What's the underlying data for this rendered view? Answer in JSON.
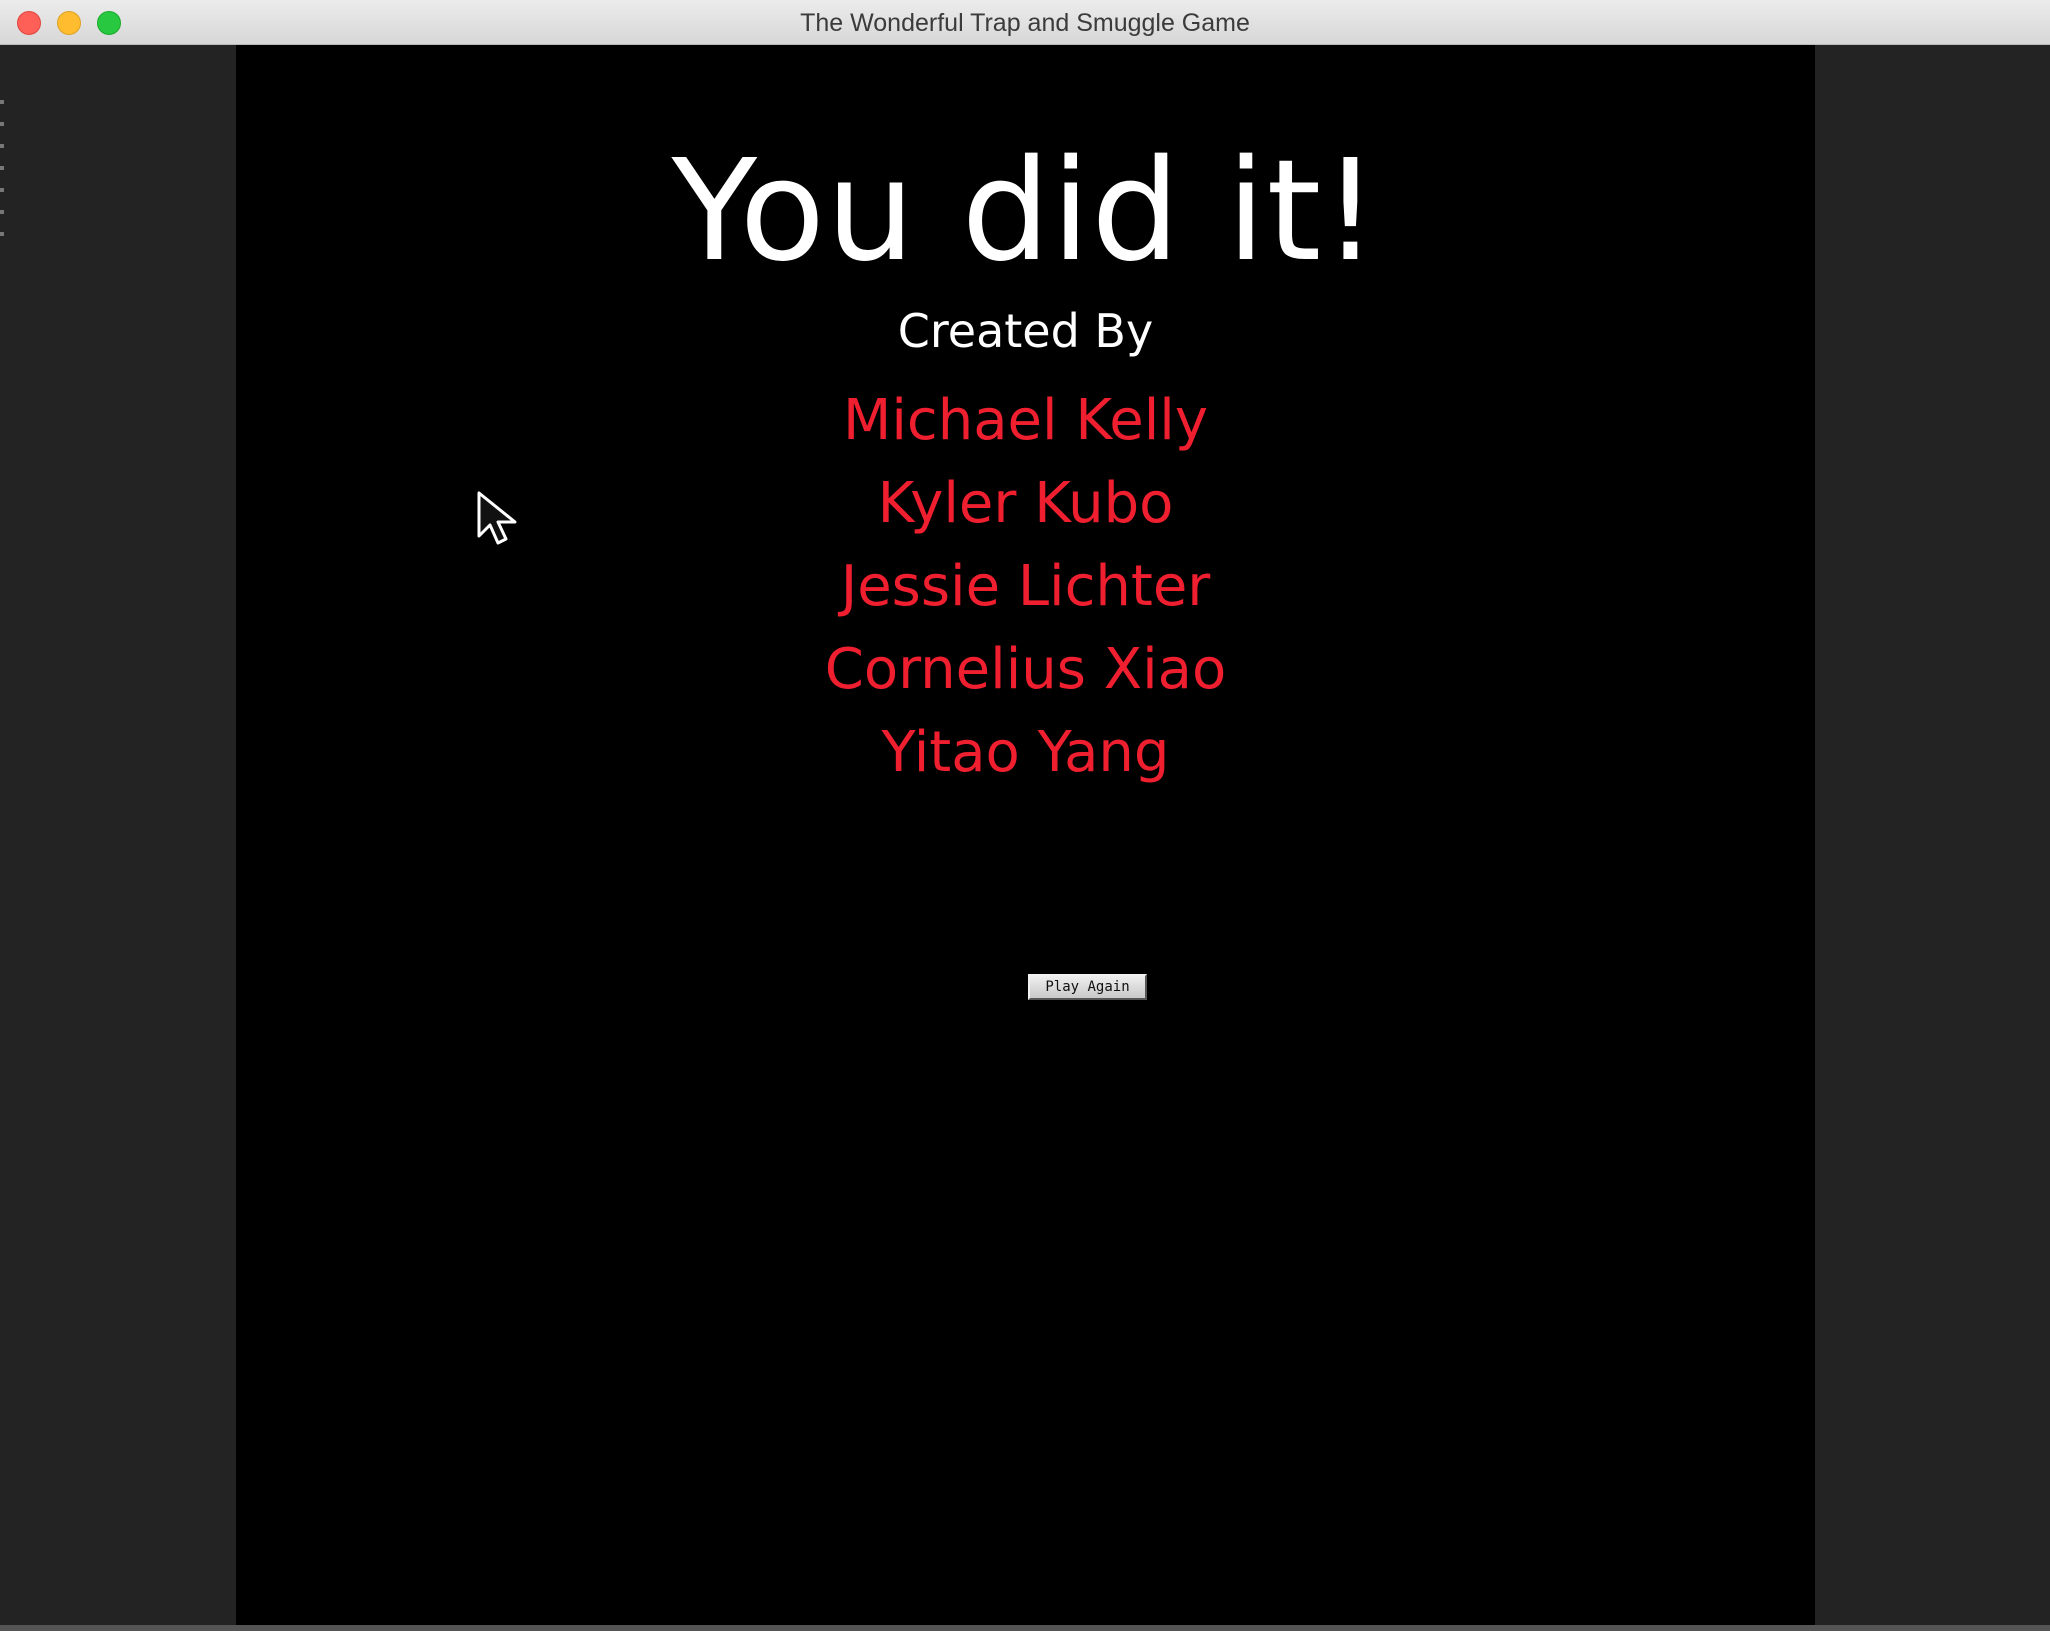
{
  "window": {
    "title": "The Wonderful Trap and Smuggle Game",
    "controls": [
      "close-icon",
      "minimize-icon",
      "zoom-icon"
    ]
  },
  "game": {
    "background_color": "#000000",
    "headline": "You did it!",
    "credits_label": "Created By",
    "credits": [
      "Michael Kelly",
      "Kyler Kubo",
      "Jessie Lichter",
      "Cornelius Xiao",
      "Yitao Yang"
    ],
    "credit_color": "#ef1f2f",
    "play_again_label": "Play Again"
  },
  "cursor": {
    "icon": "mouse-pointer-icon"
  }
}
